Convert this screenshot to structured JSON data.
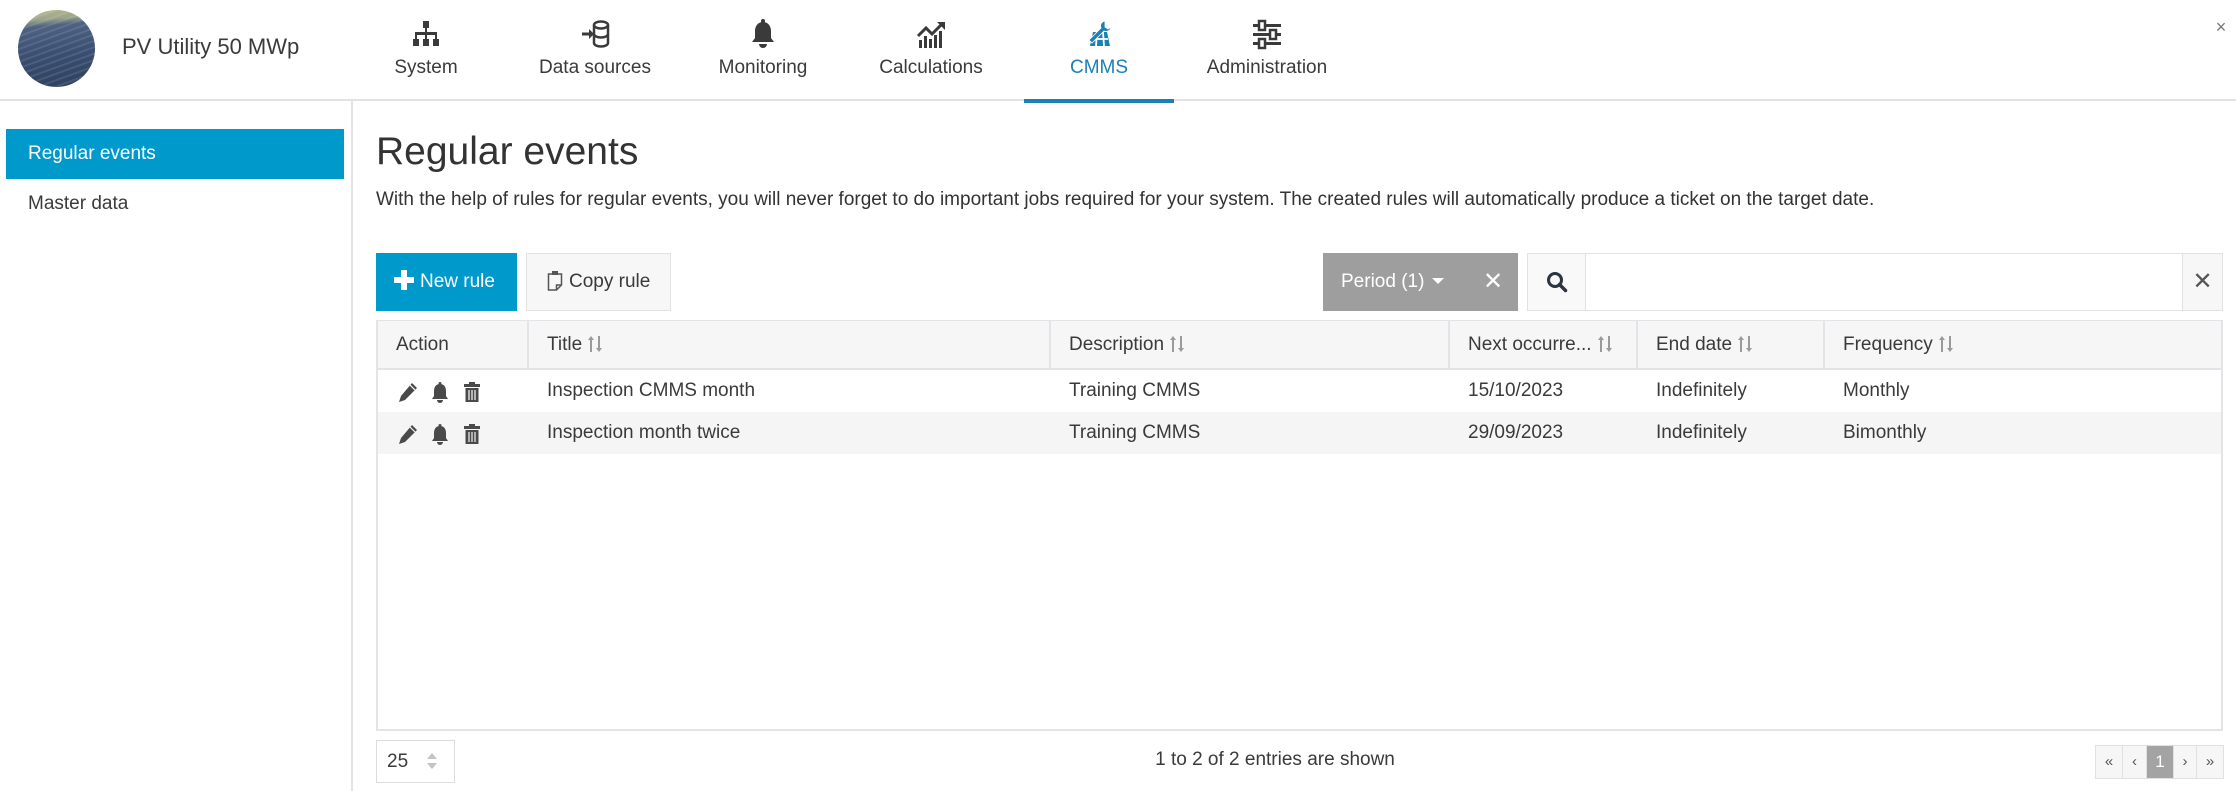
{
  "header": {
    "site_title": "PV Utility 50 MWp",
    "close_label": "×",
    "nav": [
      {
        "label": "System",
        "icon": "sitemap-icon",
        "active": false
      },
      {
        "label": "Data sources",
        "icon": "database-import-icon",
        "active": false
      },
      {
        "label": "Monitoring",
        "icon": "bell-icon",
        "active": false
      },
      {
        "label": "Calculations",
        "icon": "chart-trend-icon",
        "active": false
      },
      {
        "label": "CMMS",
        "icon": "wrench-solar-panel-icon",
        "active": true
      },
      {
        "label": "Administration",
        "icon": "sliders-icon",
        "active": false
      }
    ]
  },
  "sidebar": {
    "items": [
      {
        "label": "Regular events",
        "active": true
      },
      {
        "label": "Master data",
        "active": false
      }
    ]
  },
  "main": {
    "title": "Regular events",
    "description": "With the help of rules for regular events, you will never forget to do important jobs required for your system. The created rules will automatically produce a ticket on the target date.",
    "toolbar": {
      "new_rule_label": "New rule",
      "copy_rule_label": "Copy rule",
      "period_filter_label": "Period (1)",
      "period_clear_label": "✕",
      "search_value": "",
      "search_placeholder": "",
      "search_clear_label": "✕"
    },
    "table": {
      "columns": [
        "Action",
        "Title",
        "Description",
        "Next occurre...",
        "End date",
        "Frequency"
      ],
      "rows": [
        {
          "title": "Inspection CMMS month",
          "description": "Training CMMS",
          "next_occurrence": "15/10/2023",
          "end_date": "Indefinitely",
          "frequency": "Monthly"
        },
        {
          "title": "Inspection month twice",
          "description": "Training CMMS",
          "next_occurrence": "29/09/2023",
          "end_date": "Indefinitely",
          "frequency": "Bimonthly"
        }
      ]
    },
    "footer": {
      "page_size": "25",
      "entries_info": "1 to 2 of 2 entries are shown",
      "pager": {
        "first": "«",
        "prev": "‹",
        "current": "1",
        "next": "›",
        "last": "»"
      }
    }
  },
  "colors": {
    "accent": "#0099cc",
    "nav_active": "#1a80b6",
    "period_button": "#9e9e9e",
    "text": "#3a3a3a"
  }
}
